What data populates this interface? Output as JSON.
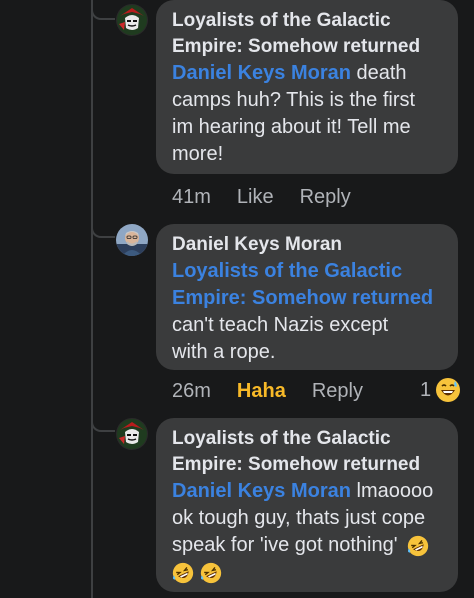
{
  "comments": [
    {
      "author": "Loyalists of the Galactic Empire: Somehow returned",
      "author_line1": "Loyalists of the Galactic",
      "author_line2": "Empire: Somehow returned",
      "mention": "Daniel Keys Moran",
      "text_after_mention_line1": " death",
      "text_line2": "camps huh? This is the first",
      "text_line3": "im hearing about it! Tell me",
      "text_line4": "more!",
      "time": "41m",
      "like_label": "Like",
      "reply_label": "Reply",
      "avatar_icon": "dark-knight-helmet-icon"
    },
    {
      "author": "Daniel Keys Moran",
      "mention_line1": "Loyalists of the Galactic",
      "mention_line2": "Empire: Somehow returned",
      "text_line1": "can't teach Nazis except",
      "text_line2": "with a rope.",
      "time": "26m",
      "like_label": "Haha",
      "reply_label": "Reply",
      "reaction_count": "1",
      "reaction_icon": "grinning-sweat-emoji-icon",
      "avatar_icon": "man-photo-icon"
    },
    {
      "author_line1": "Loyalists of the Galactic",
      "author_line2": "Empire: Somehow returned",
      "mention": "Daniel Keys Moran",
      "text_after_mention_line1": " lmaoooo",
      "text_line2": "ok tough guy, thats just cope",
      "text_line3": "speak for 'ive got nothing'",
      "trailing_emoji": "rolling-on-floor-laughing-emoji-icon",
      "avatar_icon": "dark-knight-helmet-icon"
    }
  ],
  "colors": {
    "background": "#18191a",
    "bubble": "#3a3b3c",
    "mention": "#3b82e0",
    "meta_text": "#b0b3b8",
    "haha_active": "#f7b928"
  }
}
